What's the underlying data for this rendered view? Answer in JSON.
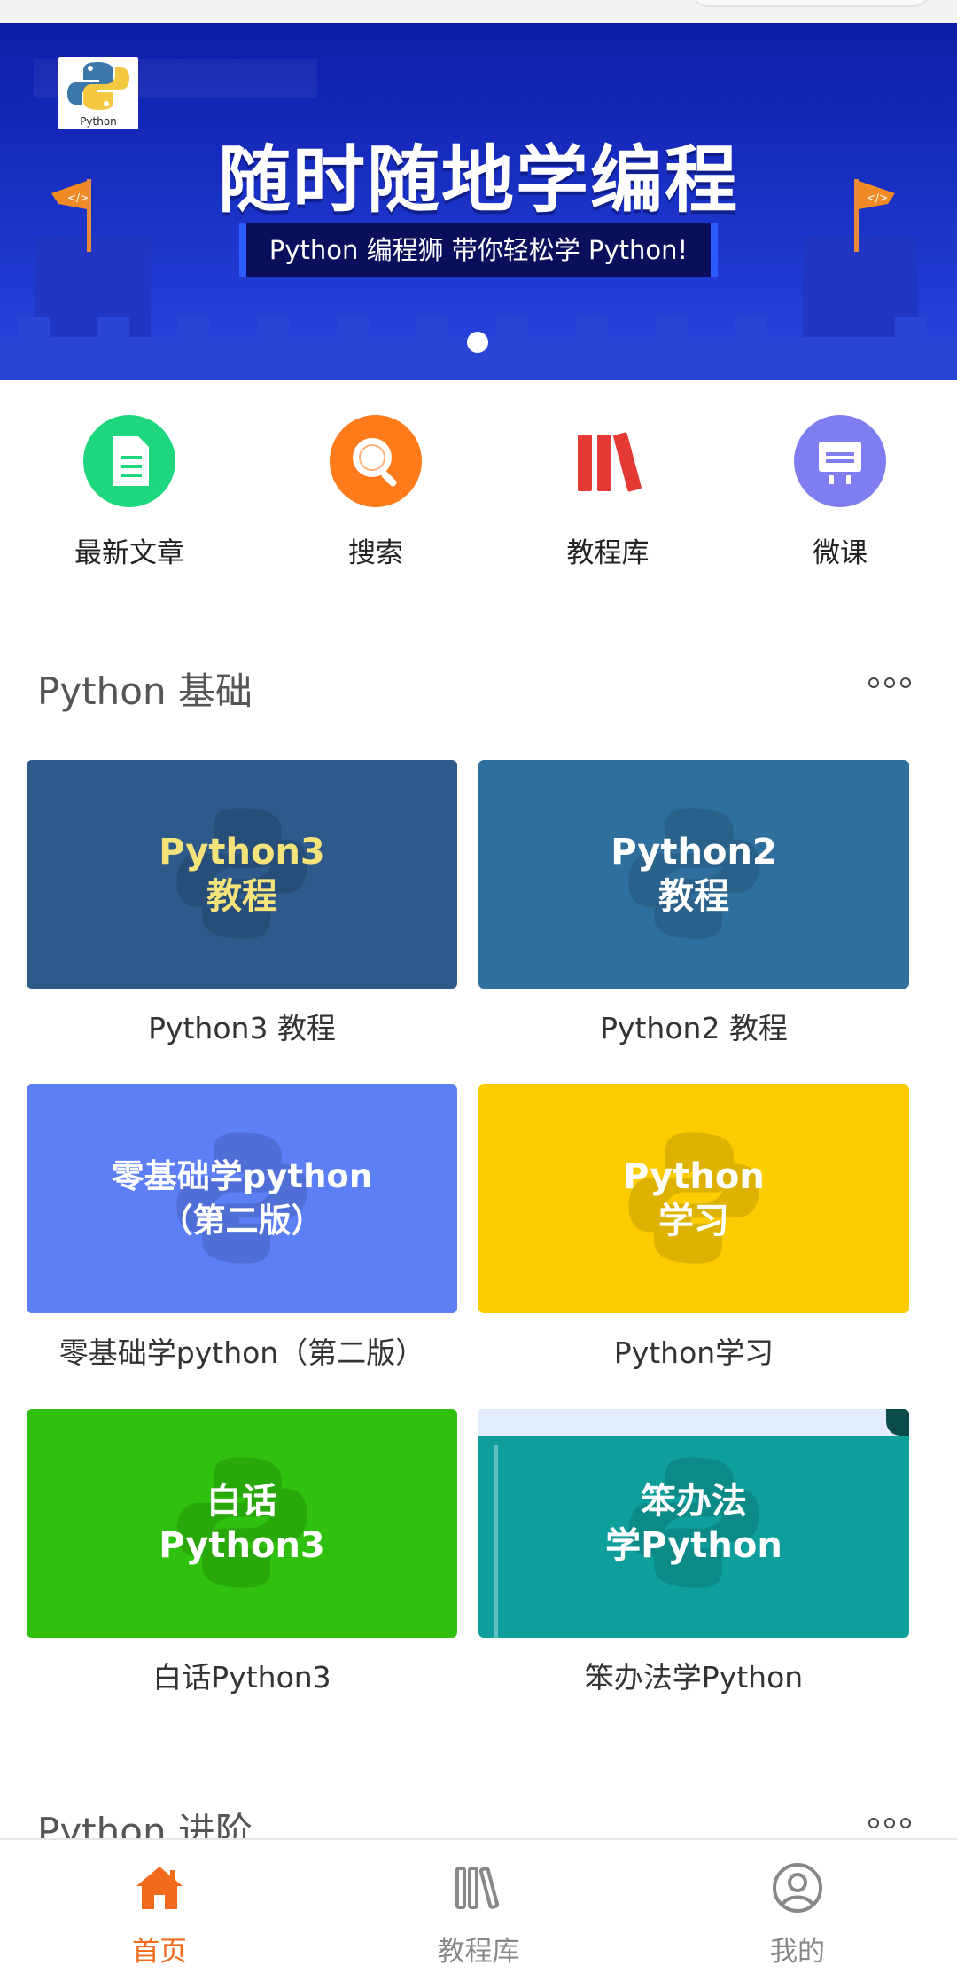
{
  "banner": {
    "logo_caption": "Python",
    "title": "随时随地学编程",
    "subtitle": "Python 编程狮 带你轻松学 Python!",
    "active_slide": 1,
    "colors": {
      "bg": "#1b33c8",
      "flag": "#f08a24"
    }
  },
  "quick_menu": [
    {
      "label": "最新文章",
      "icon": "document-icon",
      "color": "#1ed67e"
    },
    {
      "label": "搜索",
      "icon": "search-icon",
      "color": "#ff7a1a"
    },
    {
      "label": "教程库",
      "icon": "books-icon",
      "color": "#e53935"
    },
    {
      "label": "微课",
      "icon": "presentation-icon",
      "color": "#7f7ef0"
    }
  ],
  "sections": [
    {
      "title": "Python 基础",
      "courses": [
        {
          "cover_text": "Python3\n教程",
          "caption": "Python3 教程",
          "bg": "#2d5a8a",
          "fg": "#f4e27a"
        },
        {
          "cover_text": "Python2\n教程",
          "caption": "Python2 教程",
          "bg": "#2f6f9e",
          "fg": "#ffffff"
        },
        {
          "cover_text": "零基础学python\n（第二版）",
          "caption": "零基础学python（第二版）",
          "bg": "#5c7ff5",
          "fg": "#ffffff"
        },
        {
          "cover_text": "Python\n学习",
          "caption": "Python学习",
          "bg": "#fdcc00",
          "fg": "#ffffff"
        },
        {
          "cover_text": "白话\nPython3",
          "caption": "白话Python3",
          "bg": "#2fc10e",
          "fg": "#ffffff"
        },
        {
          "cover_text": "笨办法\n学Python",
          "caption": "笨办法学Python",
          "bg": "#0e9e9c",
          "fg": "#ffffff"
        }
      ]
    },
    {
      "title": "Python 进阶"
    }
  ],
  "tabbar": [
    {
      "label": "首页",
      "icon": "home-icon",
      "active": true
    },
    {
      "label": "教程库",
      "icon": "library-icon",
      "active": false
    },
    {
      "label": "我的",
      "icon": "profile-icon",
      "active": false
    }
  ],
  "colors": {
    "accent": "#f26b1d",
    "inactive": "#888888"
  }
}
